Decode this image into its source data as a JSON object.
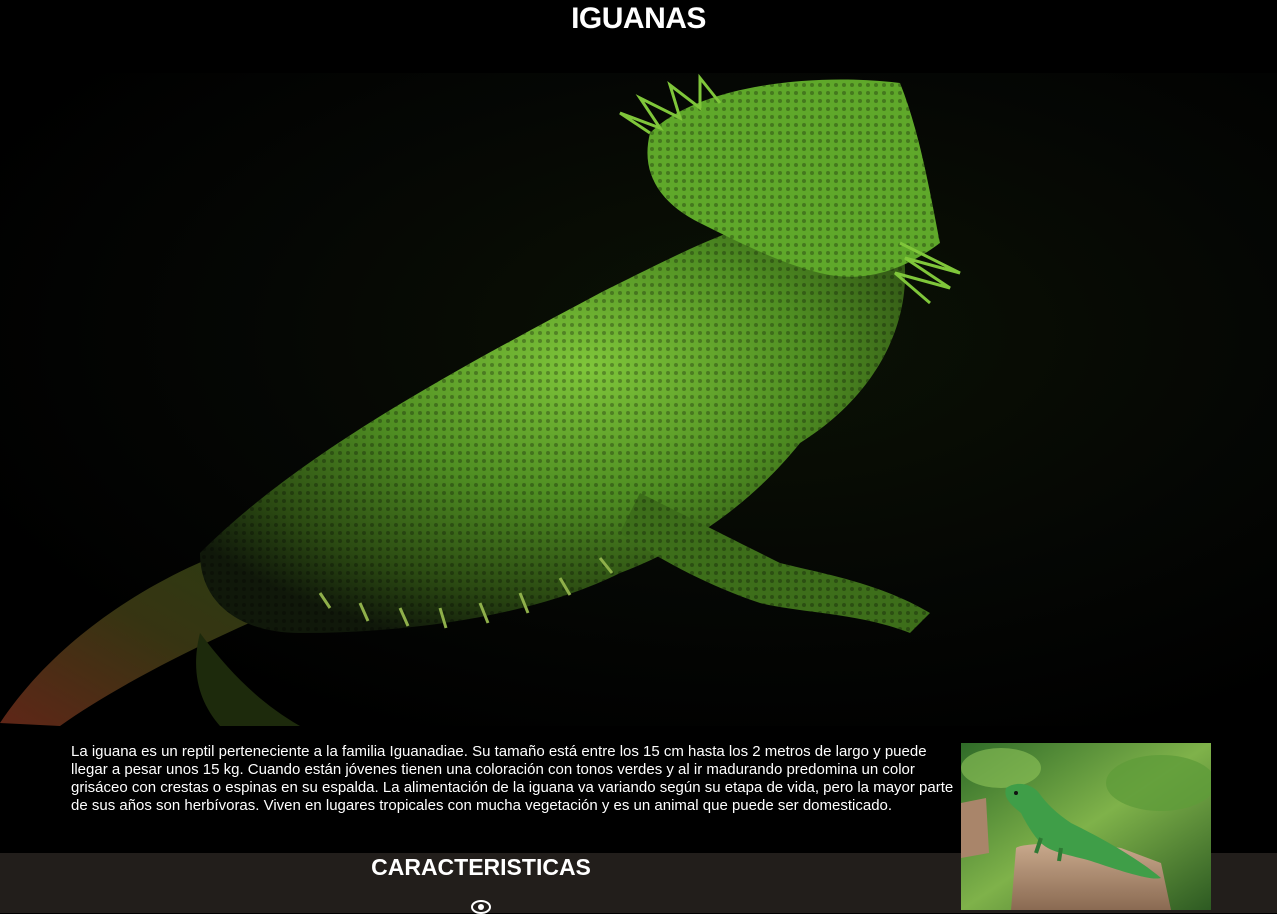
{
  "header": {
    "title": "IGUANAS"
  },
  "hero": {
    "image": "iguana-hero-photo"
  },
  "intro": {
    "text": "La iguana es un reptil perteneciente a la familia Iguanadiae. Su tamaño está entre los 15 cm hasta los 2 metros de largo y puede llegar a pesar unos 15 kg. Cuando están jóvenes tienen una coloración con tonos verdes y al ir madurando predomina un color grisáceo con crestas o espinas en su espalda. La alimentación de la iguana va variando según su etapa de vida, pero la mayor parte de sus años son herbívoras. Viven en lugares tropicales con mucha vegetación y es un animal que puede ser domesticado.",
    "photo": "iguana-on-stump-photo"
  },
  "features": {
    "title": "CARACTERISTICAS",
    "icon": "eye-icon"
  },
  "colors": {
    "background": "#000000",
    "section_background": "#221e1b",
    "text": "#ffffff"
  }
}
